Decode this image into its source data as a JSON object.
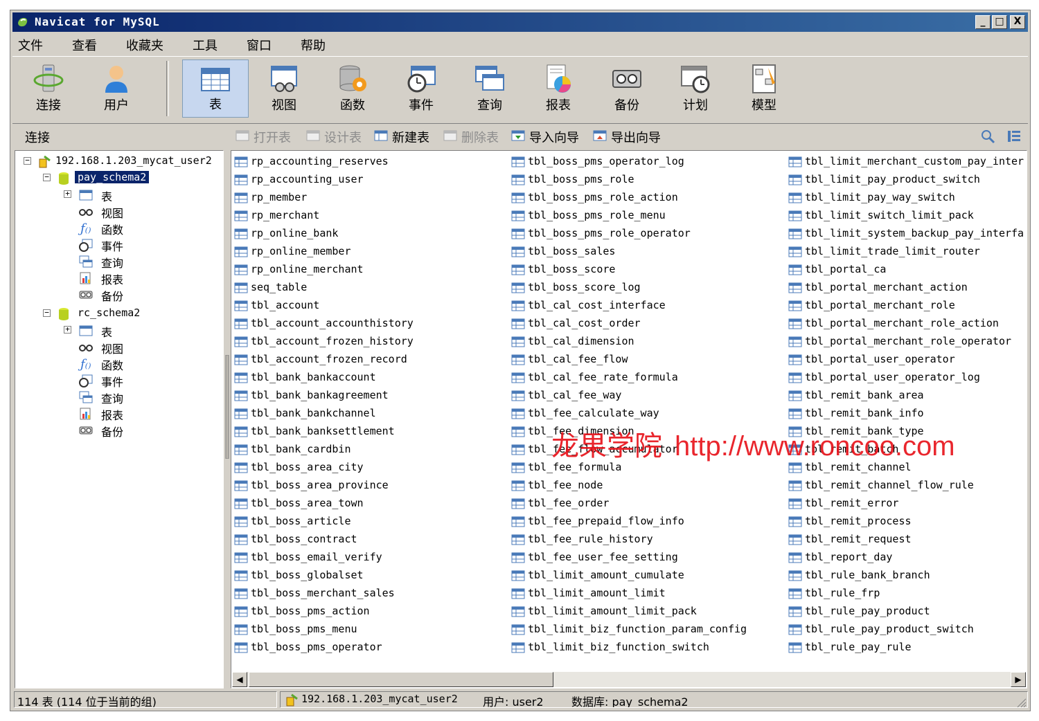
{
  "window": {
    "title": "Navicat for MySQL",
    "min": "_",
    "max": "□",
    "close": "X"
  },
  "menu": [
    "文件",
    "查看",
    "收藏夹",
    "工具",
    "窗口",
    "帮助"
  ],
  "toolbar": [
    "连接",
    "用户",
    "表",
    "视图",
    "函数",
    "事件",
    "查询",
    "报表",
    "备份",
    "计划",
    "模型"
  ],
  "subbar": {
    "connection_label": "连接",
    "actions": [
      "打开表",
      "设计表",
      "新建表",
      "删除表",
      "导入向导",
      "导出向导"
    ]
  },
  "tree": {
    "connection": "192.168.1.203_mycat_user2",
    "schema1": {
      "name": "pay_schema2",
      "children": [
        "表",
        "视图",
        "函数",
        "事件",
        "查询",
        "报表",
        "备份"
      ]
    },
    "schema2": {
      "name": "rc_schema2",
      "children": [
        "表",
        "视图",
        "函数",
        "事件",
        "查询",
        "报表",
        "备份"
      ]
    }
  },
  "tables": {
    "col1": [
      "rp_accounting_reserves",
      "rp_accounting_user",
      "rp_member",
      "rp_merchant",
      "rp_online_bank",
      "rp_online_member",
      "rp_online_merchant",
      "seq_table",
      "tbl_account",
      "tbl_account_accounthistory",
      "tbl_account_frozen_history",
      "tbl_account_frozen_record",
      "tbl_bank_bankaccount",
      "tbl_bank_bankagreement",
      "tbl_bank_bankchannel",
      "tbl_bank_banksettlement",
      "tbl_bank_cardbin",
      "tbl_boss_area_city",
      "tbl_boss_area_province",
      "tbl_boss_area_town",
      "tbl_boss_article",
      "tbl_boss_contract",
      "tbl_boss_email_verify",
      "tbl_boss_globalset",
      "tbl_boss_merchant_sales",
      "tbl_boss_pms_action",
      "tbl_boss_pms_menu",
      "tbl_boss_pms_operator"
    ],
    "col2": [
      "tbl_boss_pms_operator_log",
      "tbl_boss_pms_role",
      "tbl_boss_pms_role_action",
      "tbl_boss_pms_role_menu",
      "tbl_boss_pms_role_operator",
      "tbl_boss_sales",
      "tbl_boss_score",
      "tbl_boss_score_log",
      "tbl_cal_cost_interface",
      "tbl_cal_cost_order",
      "tbl_cal_dimension",
      "tbl_cal_fee_flow",
      "tbl_cal_fee_rate_formula",
      "tbl_cal_fee_way",
      "tbl_fee_calculate_way",
      "tbl_fee_dimension",
      "tbl_fee_flow_accumulator",
      "tbl_fee_formula",
      "tbl_fee_node",
      "tbl_fee_order",
      "tbl_fee_prepaid_flow_info",
      "tbl_fee_rule_history",
      "tbl_fee_user_fee_setting",
      "tbl_limit_amount_cumulate",
      "tbl_limit_amount_limit",
      "tbl_limit_amount_limit_pack",
      "tbl_limit_biz_function_param_config",
      "tbl_limit_biz_function_switch"
    ],
    "col3": [
      "tbl_limit_merchant_custom_pay_inter",
      "tbl_limit_pay_product_switch",
      "tbl_limit_pay_way_switch",
      "tbl_limit_switch_limit_pack",
      "tbl_limit_system_backup_pay_interfa",
      "tbl_limit_trade_limit_router",
      "tbl_portal_ca",
      "tbl_portal_merchant_action",
      "tbl_portal_merchant_role",
      "tbl_portal_merchant_role_action",
      "tbl_portal_merchant_role_operator",
      "tbl_portal_user_operator",
      "tbl_portal_user_operator_log",
      "tbl_remit_bank_area",
      "tbl_remit_bank_info",
      "tbl_remit_bank_type",
      "tbl_remit_batch",
      "tbl_remit_channel",
      "tbl_remit_channel_flow_rule",
      "tbl_remit_error",
      "tbl_remit_process",
      "tbl_remit_request",
      "tbl_report_day",
      "tbl_rule_bank_branch",
      "tbl_rule_frp",
      "tbl_rule_pay_product",
      "tbl_rule_pay_product_switch",
      "tbl_rule_pay_rule"
    ]
  },
  "watermark": {
    "cn": "龙果学院",
    "url": "http://www.roncoo.com"
  },
  "status": {
    "count": "114 表 (114 位于当前的组)",
    "connection": "192.168.1.203_mycat_user2",
    "user": "用户: user2",
    "database": "数据库: pay_schema2"
  }
}
